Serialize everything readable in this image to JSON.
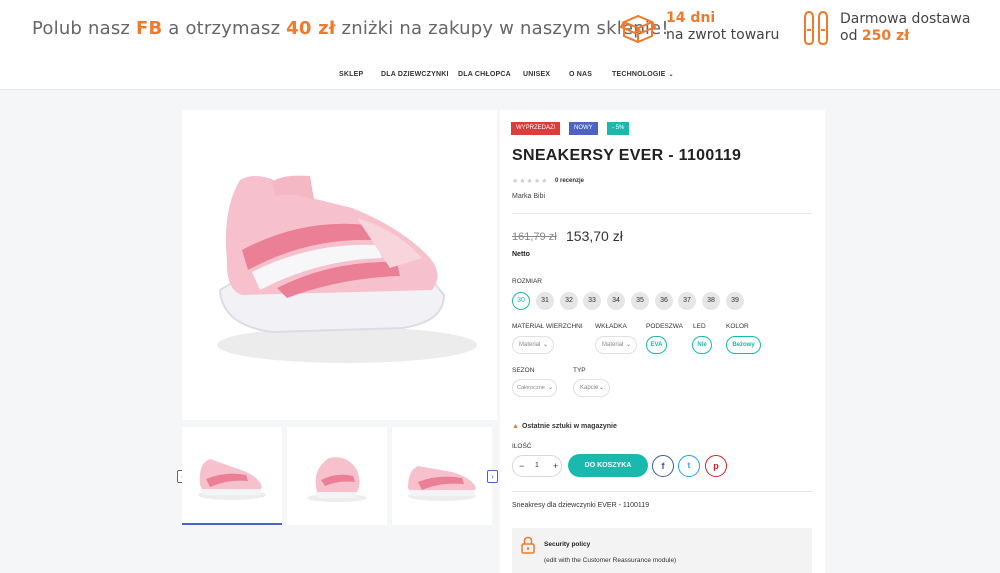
{
  "header": {
    "promo_part1": "Polub nasz ",
    "promo_fb": "FB",
    "promo_part2": " a otrzymasz ",
    "promo_amount": "40 zł",
    "promo_part3": " zniżki na zakupy w naszym sklepie!",
    "return_days": "14 dni",
    "return_text": "na zwrot towaru",
    "delivery_text": "Darmowa dostawa",
    "delivery_from": "od",
    "delivery_amount": "250 zł"
  },
  "nav": {
    "items": [
      "SKLEP",
      "DLA DZIEWCZYNKI",
      "DLA CHŁOPCA",
      "UNISEX",
      "O NAS",
      "TECHNOLOGIE"
    ]
  },
  "product": {
    "badges": [
      "WYPRZEDAŻ!",
      "NOWY",
      "- 5%"
    ],
    "title": "SNEAKERSY EVER - 1100119",
    "reviews": "0 recenzje",
    "brand": "Marka Bibi",
    "old_price": "161,79 zł",
    "price": "153,70 zł",
    "tax_label": "Netto",
    "size_label": "ROZMIAR",
    "sizes": [
      "30",
      "31",
      "32",
      "33",
      "34",
      "35",
      "36",
      "37",
      "38",
      "39"
    ],
    "selected_size": "30",
    "attr_labels": {
      "upper": "MATERIAŁ WIERZCHNI",
      "insole": "WKŁADKA",
      "sole": "PODESZWA",
      "led": "LED",
      "color": "KOLOR",
      "season": "SEZON",
      "type": "TYP"
    },
    "attr_values": {
      "upper": "Materiał",
      "insole": "Materiał",
      "sole": "EVA",
      "led": "Nie",
      "color": "Beżowy",
      "season": "Całoroczne",
      "type": "Kapcie"
    },
    "stock_warning": "Ostatnie sztuki w magazynie",
    "qty_label": "ILOŚĆ",
    "qty_value": "1",
    "qty_minus": "−",
    "qty_plus": "+",
    "cart_button": "DO KOSZYKA",
    "description": "Sneakresy dla dziewczynki EVER - 1100119",
    "reassurance_title": "Security policy",
    "reassurance_text": "(edit with the Customer Reassurance module)"
  },
  "colors": {
    "accent": "#1ab9ae",
    "orange": "#f07a2c",
    "badge_sale": "#e03b3b",
    "badge_new": "#4a63c5",
    "badge_discount": "#1ab9ae"
  }
}
